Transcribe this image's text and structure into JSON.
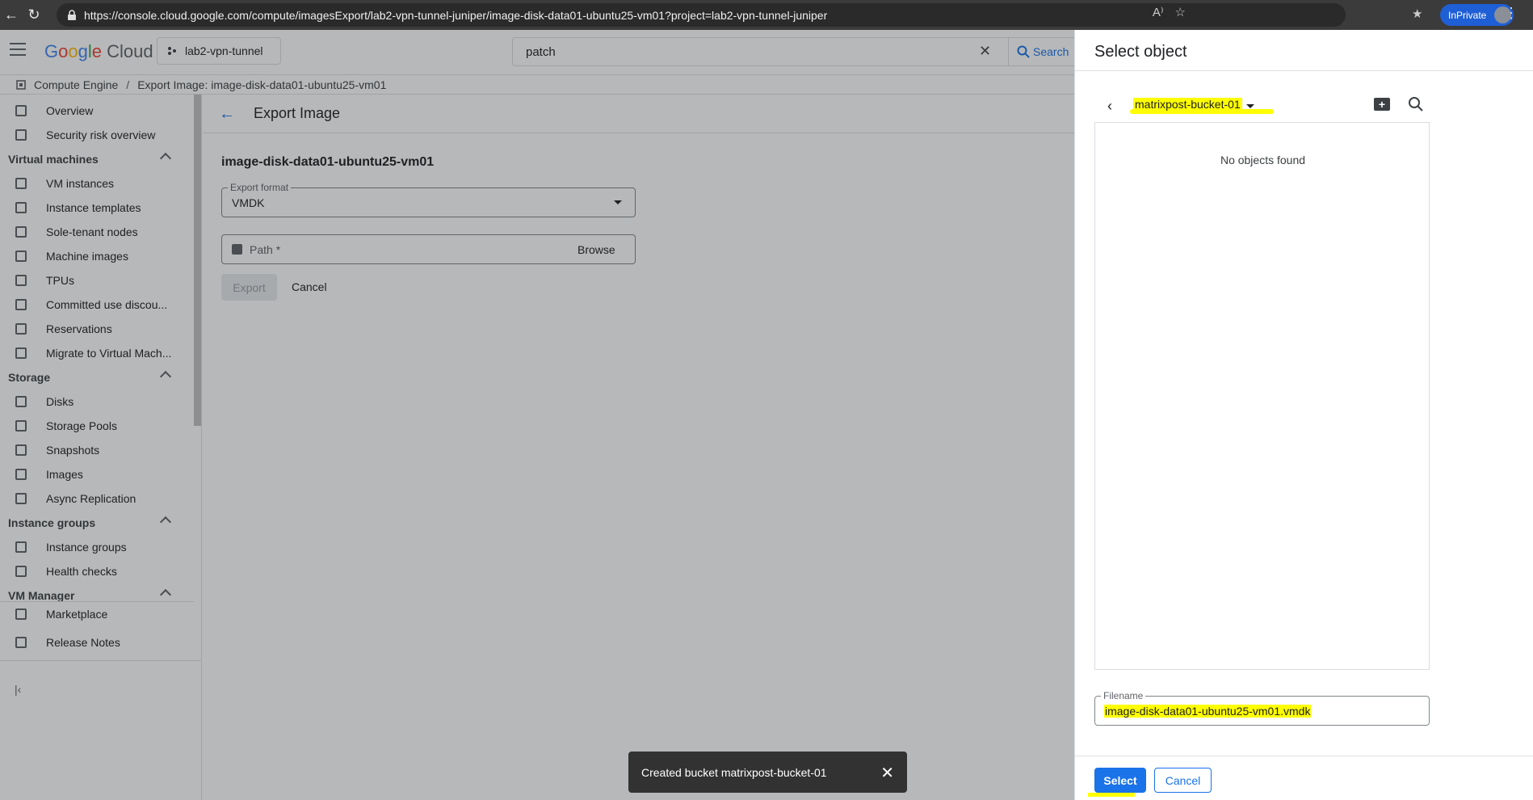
{
  "browser": {
    "url": "https://console.cloud.google.com/compute/imagesExport/lab2-vpn-tunnel-juniper/image-disk-data01-ubuntu25-vm01?project=lab2-vpn-tunnel-juniper",
    "inprivate_label": "InPrivate"
  },
  "header": {
    "logo_text": "Google Cloud",
    "project": "lab2-vpn-tunnel",
    "search_value": "patch",
    "search_button": "Search"
  },
  "breadcrumb": {
    "root": "Compute Engine",
    "separator": "/",
    "current": "Export Image: image-disk-data01-ubuntu25-vm01"
  },
  "sidebar": {
    "overview": "Overview",
    "security": "Security risk overview",
    "section_vms": "Virtual machines",
    "vm_instances": "VM instances",
    "instance_templates": "Instance templates",
    "sole_tenant": "Sole-tenant nodes",
    "machine_images": "Machine images",
    "tpus": "TPUs",
    "committed_use": "Committed use discou...",
    "reservations": "Reservations",
    "migrate": "Migrate to Virtual Mach...",
    "section_storage": "Storage",
    "disks": "Disks",
    "storage_pools": "Storage Pools",
    "snapshots": "Snapshots",
    "images": "Images",
    "async_replication": "Async Replication",
    "section_instance_groups": "Instance groups",
    "instance_groups": "Instance groups",
    "health_checks": "Health checks",
    "section_vm_manager": "VM Manager",
    "marketplace": "Marketplace",
    "release_notes": "Release Notes"
  },
  "main": {
    "title": "Export Image",
    "image_name": "image-disk-data01-ubuntu25-vm01",
    "format_label": "Export format",
    "format_value": "VMDK",
    "path_label": "Path *",
    "browse": "Browse",
    "export": "Export",
    "cancel": "Cancel"
  },
  "snackbar": {
    "message": "Created bucket matrixpost-bucket-01"
  },
  "panel": {
    "title": "Select object",
    "bucket": "matrixpost-bucket-01",
    "empty_message": "No objects found",
    "filename_label": "Filename",
    "filename_value": "image-disk-data01-ubuntu25-vm01.vmdk",
    "select": "Select",
    "cancel": "Cancel",
    "highlight_color": "#ffff00"
  }
}
